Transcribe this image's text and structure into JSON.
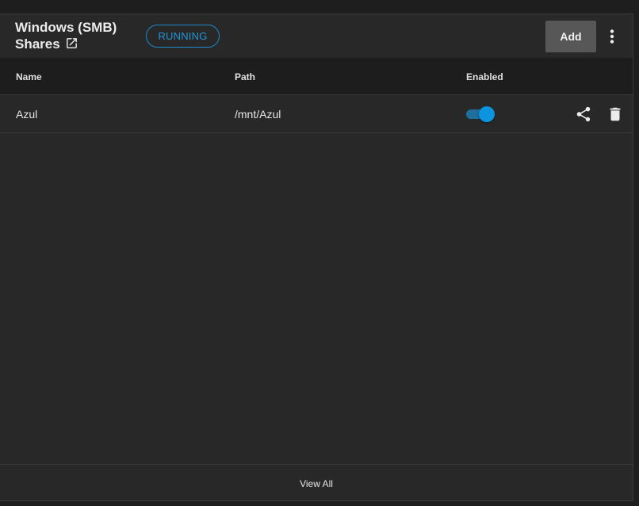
{
  "card": {
    "title_line1": "Windows (SMB)",
    "title_line2": "Shares",
    "title_icon": "open-in-new-icon",
    "status": "RUNNING",
    "add_label": "Add",
    "more_icon": "more-vertical-icon"
  },
  "table": {
    "columns": [
      "Name",
      "Path",
      "Enabled"
    ],
    "rows": [
      {
        "name": "Azul",
        "path": "/mnt/Azul",
        "enabled": true,
        "actions": [
          "share-icon",
          "delete-icon"
        ]
      }
    ]
  },
  "footer": {
    "view_all_label": "View All"
  },
  "colors": {
    "background": "#1e1e1e",
    "card": "#282828",
    "header_row": "#1d1d1d",
    "accent": "#0d94e0",
    "add_button": "#575757"
  }
}
